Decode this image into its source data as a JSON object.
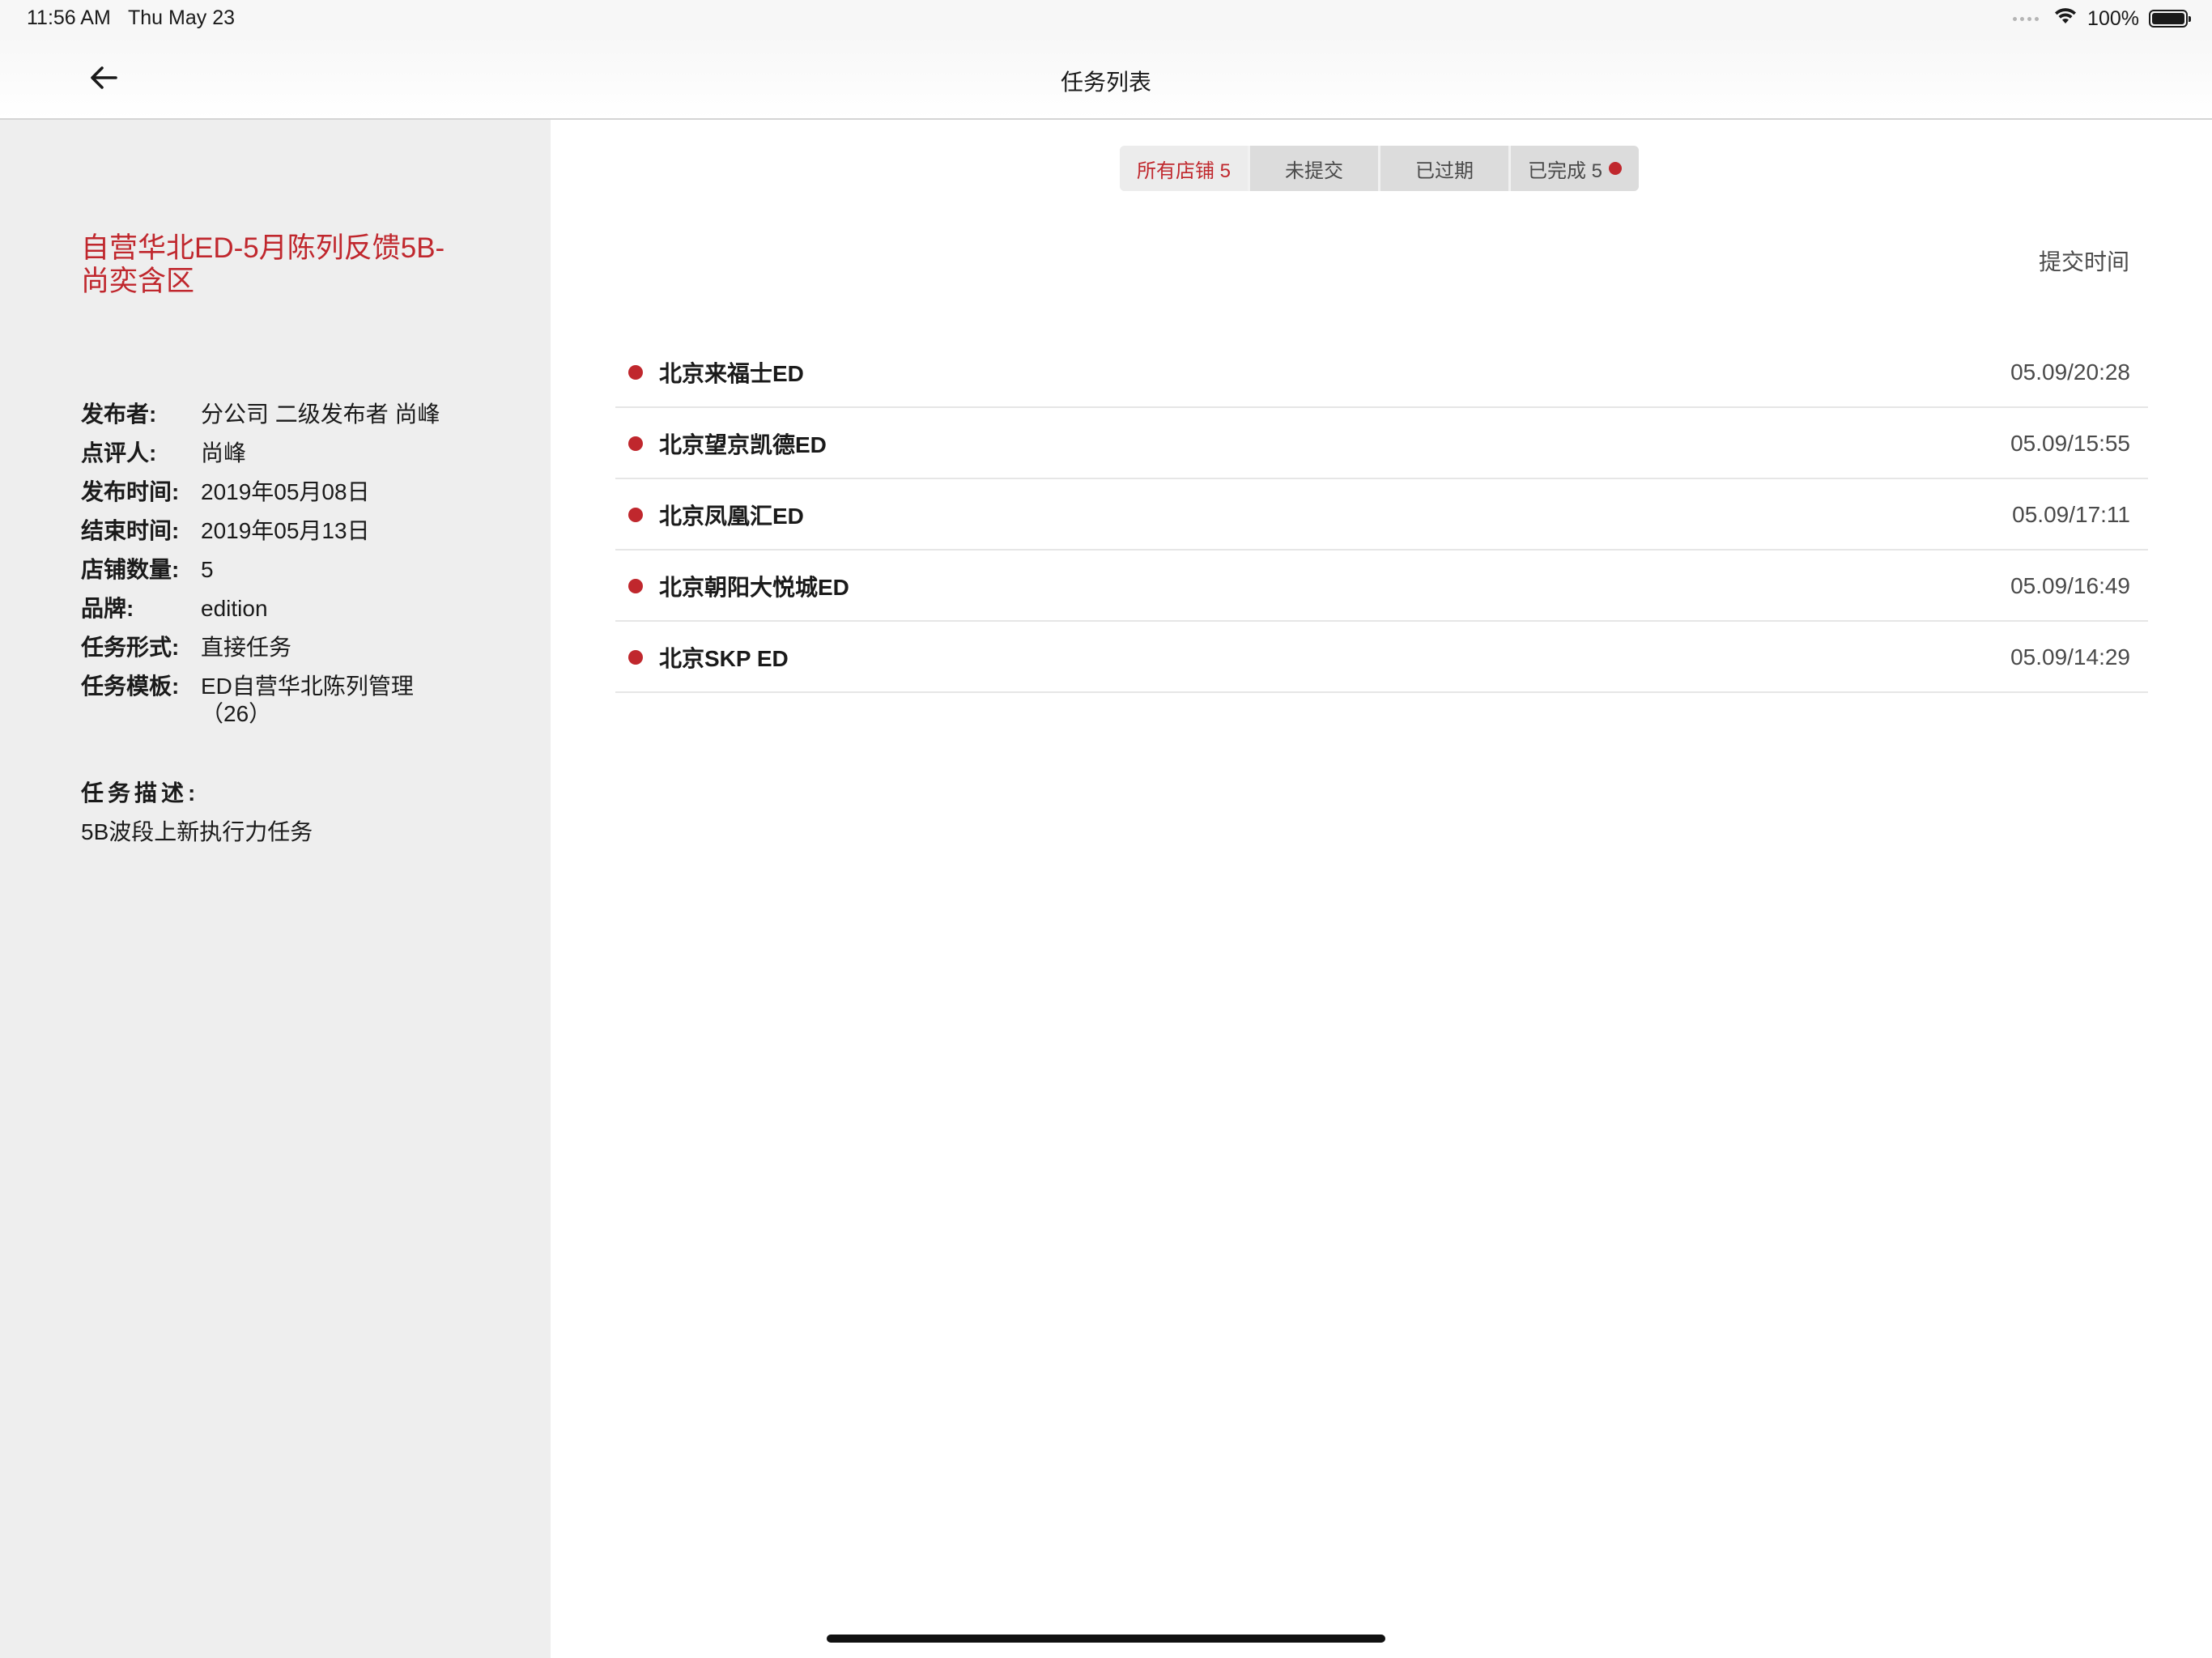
{
  "status_bar": {
    "time": "11:56 AM",
    "date": "Thu May 23",
    "battery": "100%",
    "battery_level": 1.0
  },
  "nav": {
    "title": "任务列表",
    "back_icon": "arrow-left-icon"
  },
  "task": {
    "title": "自营华北ED-5月陈列反馈5B-尚奕含区",
    "info": [
      {
        "label": "发布者:",
        "value": "分公司 二级发布者 尚峰"
      },
      {
        "label": "点评人:",
        "value": "尚峰"
      },
      {
        "label": "发布时间:",
        "value": "2019年05月08日"
      },
      {
        "label": "结束时间:",
        "value": "2019年05月13日"
      },
      {
        "label": "店铺数量:",
        "value": "5"
      },
      {
        "label": "品牌:",
        "value": "edition"
      },
      {
        "label": "任务形式:",
        "value": "直接任务"
      },
      {
        "label": "任务模板:",
        "value": "ED自营华北陈列管理（26）"
      }
    ],
    "description_label": "任务描述:",
    "description": "5B波段上新执行力任务"
  },
  "filters": [
    {
      "label": "所有店铺 5",
      "active": true,
      "has_dot": false
    },
    {
      "label": "未提交",
      "active": false,
      "has_dot": false
    },
    {
      "label": "已过期",
      "active": false,
      "has_dot": false
    },
    {
      "label": "已完成 5",
      "active": false,
      "has_dot": true
    }
  ],
  "sort_label": "提交时间",
  "stores": [
    {
      "name": "北京来福士ED",
      "time": "05.09/20:28"
    },
    {
      "name": "北京望京凯德ED",
      "time": "05.09/15:55"
    },
    {
      "name": "北京凤凰汇ED",
      "time": "05.09/17:11"
    },
    {
      "name": "北京朝阳大悦城ED",
      "time": "05.09/16:49"
    },
    {
      "name": "北京SKP ED",
      "time": "05.09/14:29"
    }
  ],
  "colors": {
    "accent": "#c0272d",
    "sidebar_bg": "#eeeeee",
    "text": "#1a1a1a"
  }
}
